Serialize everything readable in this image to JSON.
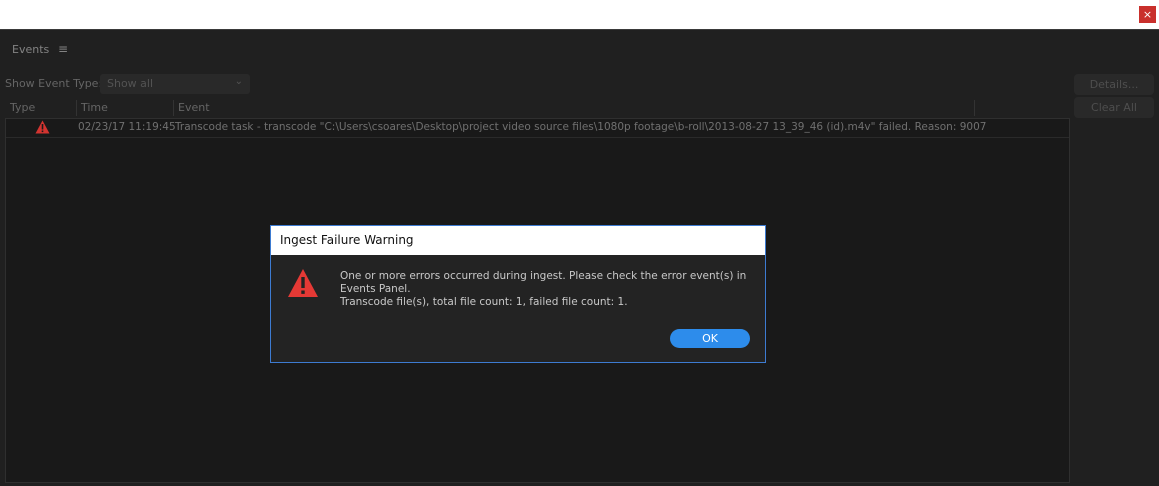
{
  "window": {
    "close_glyph": "×"
  },
  "panel": {
    "tab_label": "Events",
    "menu_glyph": "≡",
    "filter": {
      "label": "Show Event Type:",
      "selected": "Show all",
      "caret": "⌄"
    },
    "buttons": {
      "details": "Details...",
      "clear_all": "Clear All"
    },
    "table": {
      "headers": {
        "type": "Type",
        "time": "Time",
        "event": "Event"
      },
      "rows": [
        {
          "type_icon": "warning-icon",
          "time": "02/23/17 11:19:45",
          "event": "Transcode task - transcode \"C:\\Users\\csoares\\Desktop\\project video source files\\1080p footage\\b-roll\\2013-08-27 13_39_46 (id).m4v\" failed. Reason: 9007"
        }
      ]
    }
  },
  "dialog": {
    "title": "Ingest Failure Warning",
    "icon": "warning-icon",
    "message_line1": "One or more errors occurred during ingest. Please check the error event(s) in",
    "message_line2": "Events Panel.",
    "message_line3": "Transcode file(s), total file count: 1, failed file count: 1.",
    "ok_label": "OK"
  },
  "colors": {
    "warning": "#e53935",
    "accent": "#2d8ceb",
    "dialog_border": "#3d7bd1"
  }
}
